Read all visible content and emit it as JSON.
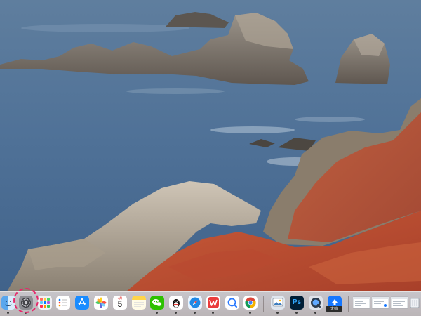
{
  "desktop": {
    "wallpaper": "coastal-rocks-wallpaper"
  },
  "dock": {
    "items": [
      {
        "name": "finder",
        "icon": "finder-icon",
        "running": true
      },
      {
        "name": "system-preferences",
        "icon": "gear-icon",
        "running": true,
        "highlighted": true
      },
      {
        "name": "launchpad",
        "icon": "launchpad-icon",
        "running": false
      },
      {
        "name": "reminders",
        "icon": "reminders-icon",
        "running": false
      },
      {
        "name": "app-store",
        "icon": "app-store-icon",
        "running": false
      },
      {
        "name": "photos",
        "icon": "photos-icon",
        "running": false
      },
      {
        "name": "calendar",
        "icon": "calendar-icon",
        "running": false
      },
      {
        "name": "notes",
        "icon": "notes-icon",
        "running": false
      },
      {
        "name": "wechat",
        "icon": "wechat-icon",
        "running": true
      },
      {
        "name": "qq",
        "icon": "penguin-icon",
        "running": true
      },
      {
        "name": "safari",
        "icon": "compass-icon",
        "running": true
      },
      {
        "name": "wps-office",
        "icon": "wps-icon",
        "running": true
      },
      {
        "name": "quark",
        "icon": "search-magnifier-icon",
        "running": false
      },
      {
        "name": "chrome",
        "icon": "chrome-icon",
        "running": true
      },
      {
        "name": "preview",
        "icon": "preview-icon",
        "running": true
      },
      {
        "name": "photoshop",
        "icon": "photoshop-icon",
        "running": true
      },
      {
        "name": "quicktime",
        "icon": "quicktime-icon",
        "running": true
      },
      {
        "name": "upload-app",
        "icon": "upload-icon",
        "running": true
      },
      {
        "name": "minimized-window-1",
        "icon": "window-thumbnail-icon",
        "running": false
      },
      {
        "name": "minimized-window-2",
        "icon": "window-thumbnail-icon",
        "running": false
      },
      {
        "name": "minimized-window-3",
        "icon": "window-thumbnail-icon",
        "running": false
      },
      {
        "name": "trash",
        "icon": "trash-icon",
        "running": false
      }
    ],
    "calendar": {
      "month": "4月",
      "day": "5"
    },
    "photoshop_label": "Ps",
    "upload_tooltip": "文档"
  },
  "colors": {
    "highlight_ring": "#e8266a",
    "dock_background": "#e2d3cd"
  }
}
